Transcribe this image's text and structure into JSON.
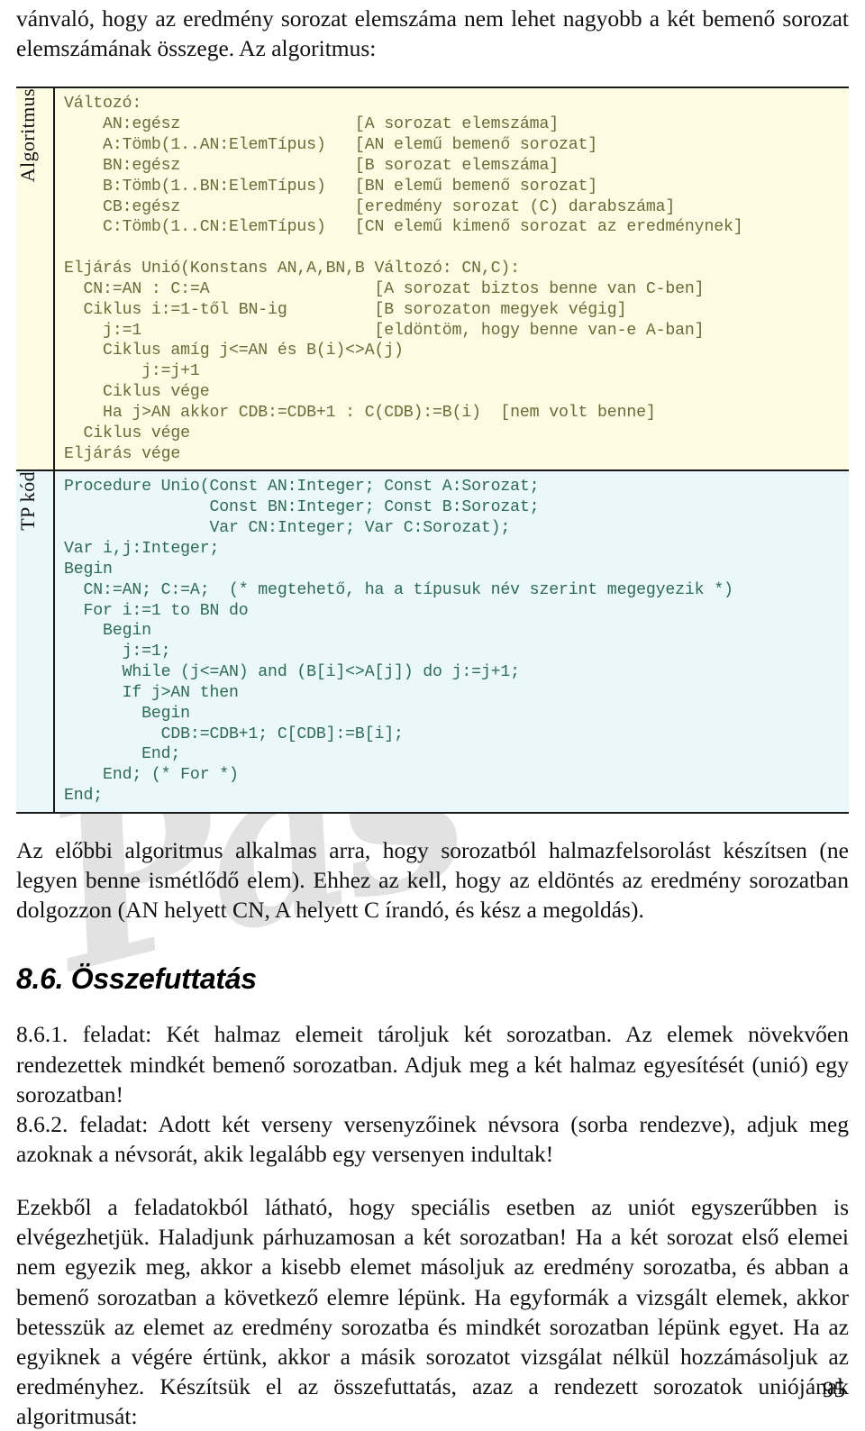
{
  "document": {
    "page_number": "95",
    "watermark_text": "Pás"
  },
  "intro": {
    "paragraph": "vánvaló, hogy az eredmény sorozat elemszáma nem lehet nagyobb a két bemenő sorozat elemszámának összege. Az algoritmus:"
  },
  "code_table": {
    "rows": [
      {
        "label": "Algoritmus",
        "code": "Változó:\n    AN:egész                  [A sorozat elemszáma]\n    A:Tömb(1..AN:ElemTípus)   [AN elemű bemenő sorozat]\n    BN:egész                  [B sorozat elemszáma]\n    B:Tömb(1..BN:ElemTípus)   [BN elemű bemenő sorozat]\n    CB:egész                  [eredmény sorozat (C) darabszáma]\n    C:Tömb(1..CN:ElemTípus)   [CN elemű kimenő sorozat az eredménynek]\n\nEljárás Unió(Konstans AN,A,BN,B Változó: CN,C):\n  CN:=AN : C:=A                 [A sorozat biztos benne van C-ben]\n  Ciklus i:=1-től BN-ig         [B sorozaton megyek végig]\n    j:=1                        [eldöntöm, hogy benne van-e A-ban]\n    Ciklus amíg j<=AN és B(i)<>A(j)\n        j:=j+1\n    Ciklus vége\n    Ha j>AN akkor CDB:=CDB+1 : C(CDB):=B(i)  [nem volt benne]\n  Ciklus vége\nEljárás vége"
      },
      {
        "label": "TP kód",
        "code": "Procedure Unio(Const AN:Integer; Const A:Sorozat;\n               Const BN:Integer; Const B:Sorozat;\n               Var CN:Integer; Var C:Sorozat);\nVar i,j:Integer;\nBegin\n  CN:=AN; C:=A;  (* megtehető, ha a típusuk név szerint megegyezik *)\n  For i:=1 to BN do\n    Begin\n      j:=1;\n      While (j<=AN) and (B[i]<>A[j]) do j:=j+1;\n      If j>AN then\n        Begin\n          CDB:=CDB+1; C[CDB]:=B[i];\n        End;\n    End; (* For *)\nEnd;"
      }
    ]
  },
  "after_code": {
    "paragraph": "Az előbbi algoritmus alkalmas arra, hogy sorozatból halmazfelsorolást készítsen (ne legyen benne ismétlődő elem). Ehhez az kell, hogy az eldöntés az eredmény sorozatban dolgozzon (AN helyett CN, A helyett C írandó, és kész a megoldás)."
  },
  "section": {
    "heading": "8.6. Összefuttatás",
    "tasks": [
      "8.6.1. feladat: Két halmaz elemeit tároljuk két sorozatban. Az elemek növekvően rendezettek mindkét bemenő sorozatban. Adjuk meg a két halmaz egyesítését (unió) egy sorozatban!",
      "8.6.2. feladat: Adott két verseny versenyzőinek névsora (sorba rendezve), adjuk meg azoknak a névsorát, akik legalább egy versenyen indultak!"
    ],
    "closing": "Ezekből a feladatokból látható, hogy speciális esetben az uniót egyszerűbben is elvégezhetjük. Haladjunk párhuzamosan a két sorozatban! Ha a két sorozat első elemei nem egyezik meg, akkor a kisebb elemet másoljuk az eredmény sorozatba, és abban a bemenő sorozatban a következő elemre lépünk. Ha egyformák a vizsgált elemek, akkor betesszük az elemet az eredmény sorozatba és mindkét sorozatban lépünk egyet. Ha az egyiknek a végére értünk, akkor a másik sorozatot vizsgálat nélkül hozzámásoljuk az eredményhez. Készítsük el az összefuttatás, azaz a rendezett sorozatok uniójának algoritmusát:"
  },
  "colors": {
    "algorithm_background": "#fdfbe2",
    "algorithm_text": "#6b6b3a",
    "tp_background": "#eaf7fb",
    "tp_text": "#2f6b52",
    "border": "#1a1a1a",
    "watermark": "#e2e2e2"
  }
}
